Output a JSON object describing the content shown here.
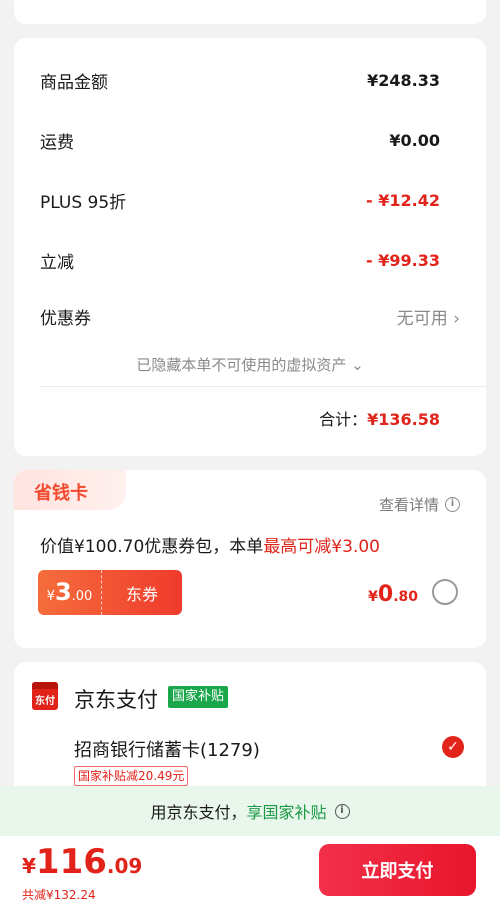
{
  "summary": {
    "goods_label": "商品金额",
    "goods_value": "¥248.33",
    "shipping_label": "运费",
    "shipping_value": "¥0.00",
    "plus_label": "PLUS 95折",
    "plus_value": "- ¥12.42",
    "instant_label": "立减",
    "instant_value": "- ¥99.33",
    "coupon_label": "优惠券",
    "coupon_value": "无可用",
    "hidden_assets": "已隐藏本单不可使用的虚拟资产",
    "total_label": "合计：",
    "total_value": "¥136.58"
  },
  "saver_card": {
    "tag": "省钱卡",
    "detail": "查看详情",
    "desc_prefix": "价值¥100.70优惠券包，本单",
    "desc_highlight": "最高可减¥3.00",
    "coupon_currency": "¥",
    "coupon_int": "3",
    "coupon_dec": ".00",
    "coupon_label": "东券",
    "price_currency": "¥",
    "price_int": "0",
    "price_dec": ".80"
  },
  "payment": {
    "icon_text": "东付",
    "title": "京东支付",
    "badge": "国家补贴",
    "bank": "招商银行储蓄卡(1279)",
    "subsidy": "国家补贴减20.49元"
  },
  "banner": {
    "text_prefix": "用京东支付，",
    "text_highlight": "享国家补贴"
  },
  "bottom": {
    "currency": "¥",
    "int": "116",
    "dec": ".09",
    "saved": "共减¥132.24",
    "pay_button": "立即支付"
  },
  "colors": {
    "accent": "#e2231a",
    "green": "#1aa64a",
    "banner_bg": "#e9f6ec"
  }
}
